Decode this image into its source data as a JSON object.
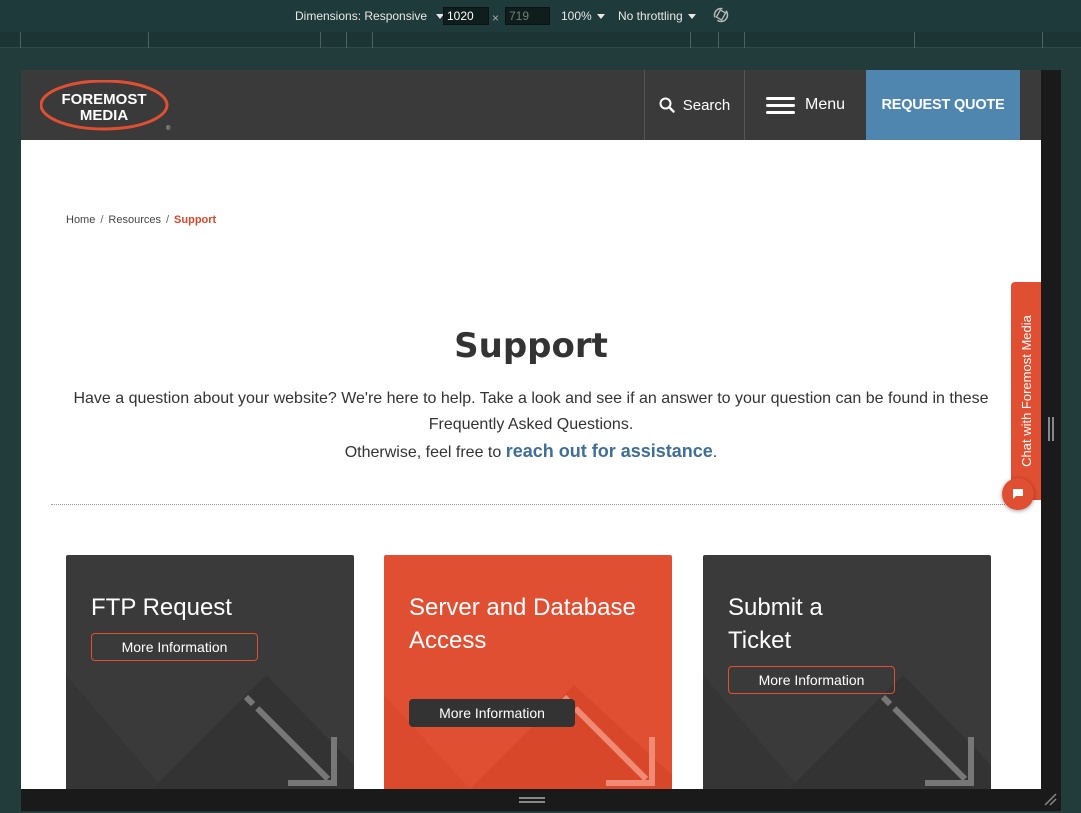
{
  "devtools": {
    "dimensions_label": "Dimensions: Responsive",
    "width_value": "1020",
    "height_value": "719",
    "times": "×",
    "zoom": "100%",
    "throttling": "No throttling"
  },
  "header": {
    "logo_line1": "FOREMOST",
    "logo_line2": "MEDIA",
    "search_label": "Search",
    "menu_label": "Menu",
    "quote_label": "REQUEST QUOTE"
  },
  "breadcrumb": {
    "items": [
      "Home",
      "Resources",
      "Support"
    ],
    "separator": "/"
  },
  "hero": {
    "title": "Support",
    "line1": "Have a question about your website? We're here to help. Take a look and see if an answer to your question can be found in these Frequently Asked Questions.",
    "line2_prefix": "Otherwise, feel free to ",
    "link_text": "reach out for assistance",
    "line2_suffix": "."
  },
  "cards": [
    {
      "title": "FTP Request",
      "button": "More Information"
    },
    {
      "title": "Server and Database Access",
      "button": "More Information"
    },
    {
      "title": "Submit a Ticket",
      "button": "More Information"
    }
  ],
  "chat": {
    "tab_label": "Chat with Foremost Media"
  },
  "colors": {
    "brand_orange": "#e14f33",
    "header_dark": "#3a3a3a",
    "quote_blue": "#4f86b0",
    "link_blue": "#3f6f96"
  }
}
